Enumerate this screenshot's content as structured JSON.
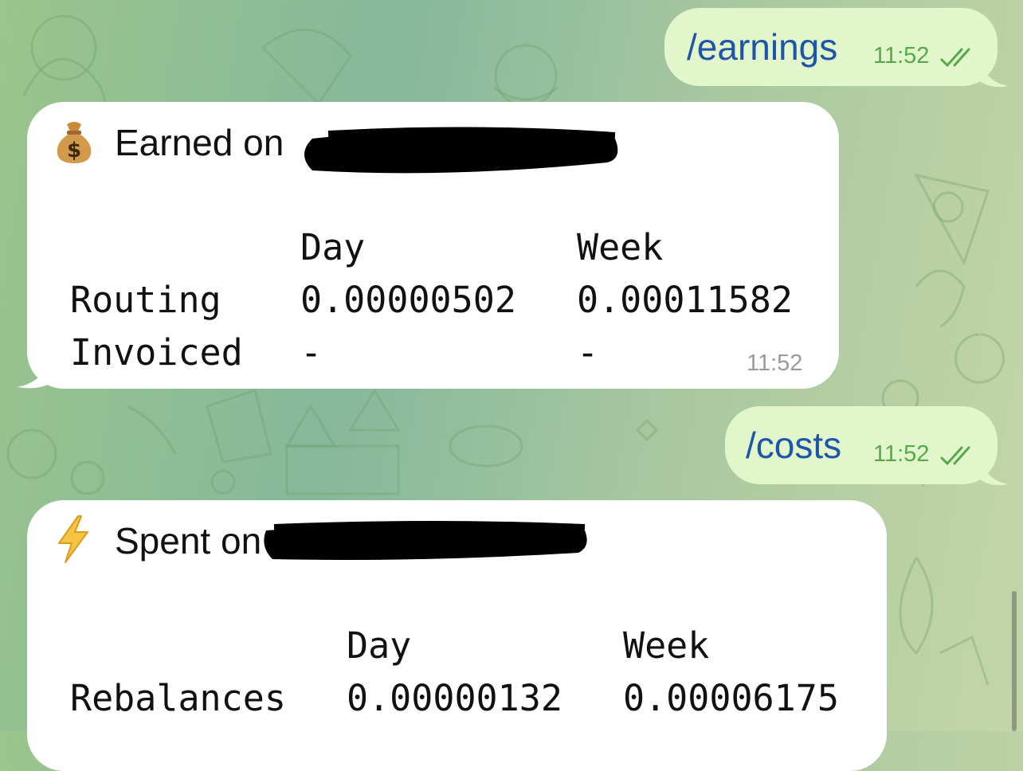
{
  "messages": {
    "cmd1": {
      "text": "/earnings",
      "time": "11:52"
    },
    "earnings": {
      "icon": "money-bag-icon",
      "title": "Earned on",
      "time": "11:52",
      "headers": [
        "Day",
        "Week"
      ],
      "rows": [
        {
          "label": "Routing",
          "day": "0.00000502",
          "week": "0.00011582"
        },
        {
          "label": "Invoiced",
          "day": "-",
          "week": "-"
        }
      ]
    },
    "cmd2": {
      "text": "/costs",
      "time": "11:52"
    },
    "costs": {
      "icon": "lightning-icon",
      "title": "Spent on",
      "headers": [
        "Day",
        "Week"
      ],
      "rows": [
        {
          "label": "Rebalances",
          "day": "0.00000132",
          "week": "0.00006175"
        }
      ]
    }
  },
  "colors": {
    "outgoing_bubble": "#e1f7cb",
    "incoming_bubble": "#ffffff",
    "command_text": "#1f55a8",
    "read_check": "#56a84a"
  }
}
